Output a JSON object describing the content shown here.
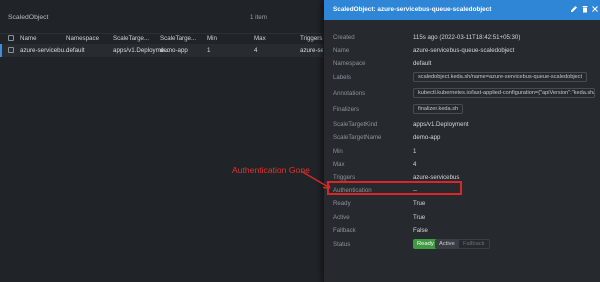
{
  "list": {
    "title": "ScaledObject",
    "count": "1 item",
    "columns": [
      "Name",
      "Namespace",
      "ScaleTarge...",
      "ScaleTarge...",
      "Min",
      "Max",
      "Triggers"
    ],
    "row": {
      "name": "azure-servicebu...",
      "namespace": "default",
      "target_kind": "apps/v1.Deployme...",
      "target_name": "demo-app",
      "min": "1",
      "max": "4",
      "triggers": "azure-se"
    }
  },
  "details": {
    "title": "ScaledObject: azure-servicebus-queue-scaledobject",
    "icons": [
      "edit-icon",
      "delete-icon",
      "close-icon"
    ],
    "fields": {
      "created_label": "Created",
      "created_value": "115s ago (2022-03-11T18:42:51+05:30)",
      "name_label": "Name",
      "name_value": "azure-servicebus-queue-scaledobject",
      "namespace_label": "Namespace",
      "namespace_value": "default",
      "labels_label": "Labels",
      "labels_value": "scaledobject.keda.sh/name=azure-servicebus-queue-scaledobject",
      "annotations_label": "Annotations",
      "annotations_value": "kubectl.kubernetes.io/last-applied-configuration={\"apiVersion\":\"keda.sh/v...",
      "finalizers_label": "Finalizers",
      "finalizers_value": "finalizer.keda.sh",
      "target_kind_label": "ScaleTargetKind",
      "target_kind_value": "apps/v1.Deployment",
      "target_name_label": "ScaleTargetName",
      "target_name_value": "demo-app",
      "min_label": "Min",
      "min_value": "1",
      "max_label": "Max",
      "max_value": "4",
      "triggers_label": "Triggers",
      "triggers_value": "azure-servicebus",
      "auth_label": "Authentication",
      "auth_value": "--",
      "ready_label": "Ready",
      "ready_value": "True",
      "active_label": "Active",
      "active_value": "True",
      "fallback_label": "Fallback",
      "fallback_value": "False",
      "status_label": "Status",
      "status_ready": "Ready",
      "status_active": "Active",
      "status_fallback": "Fallback"
    }
  },
  "annotation": {
    "text": "Authentication Gone",
    "color": "#e5322f"
  },
  "colors": {
    "accent": "#2f85d6",
    "ready": "#3f9a42"
  }
}
